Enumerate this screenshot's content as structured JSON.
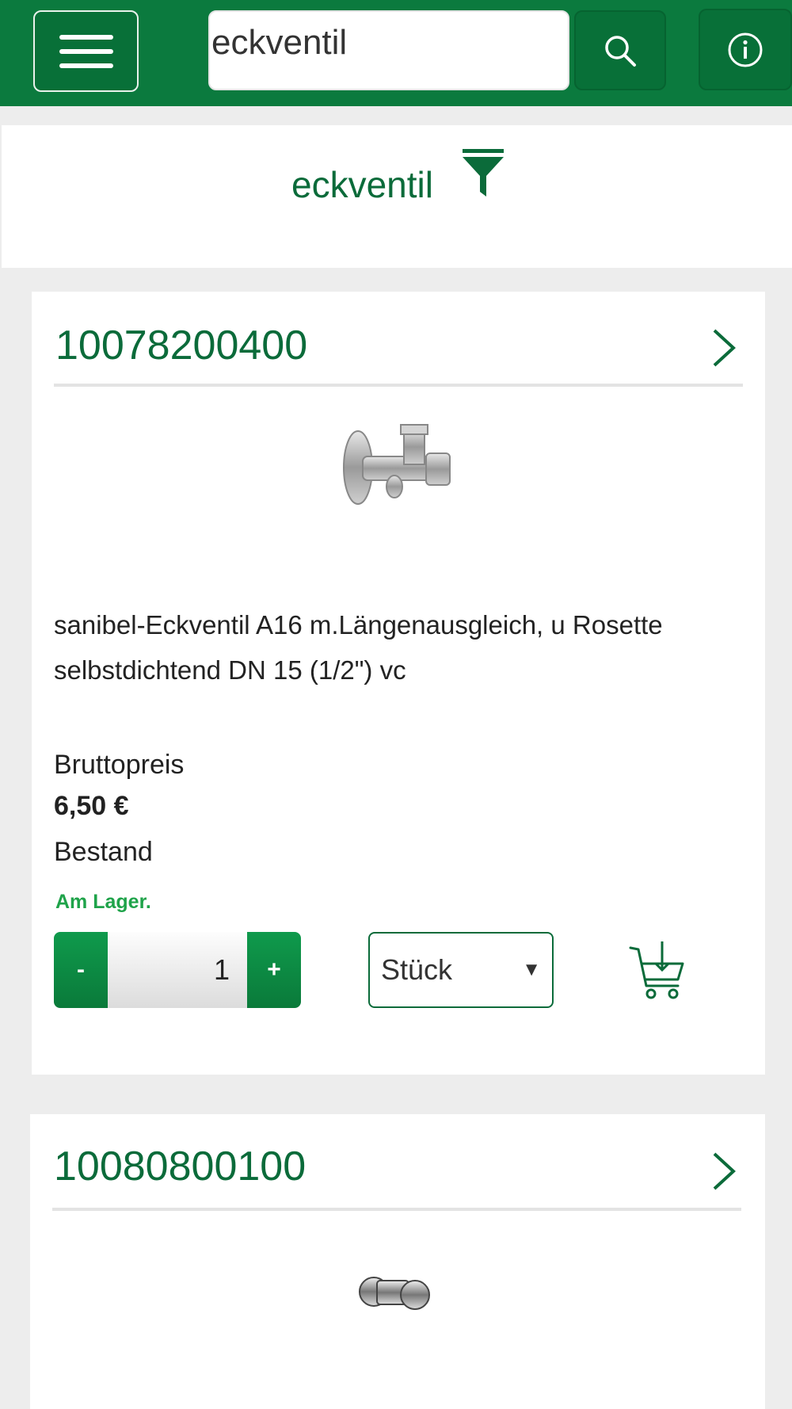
{
  "header": {
    "search_value": "eckventil",
    "menu_icon": "hamburger-icon",
    "search_icon": "search-icon",
    "info_icon": "info-icon",
    "brand_color": "#0b7a3e"
  },
  "filter": {
    "label": "eckventil",
    "icon": "filter-icon"
  },
  "products": [
    {
      "number": "10078200400",
      "description": "sanibel-Eckventil A16 m.Längenausgleich, u Rosette selbstdichtend DN 15 (1/2\") vc",
      "price_label": "Bruttopreis",
      "price": "6,50 €",
      "stock_label": "Bestand",
      "stock_status": "Am Lager.",
      "quantity": {
        "minus": "-",
        "value": "1",
        "plus": "+"
      },
      "unit": "Stück",
      "unit_arrow": "▼",
      "cart_icon": "add-to-cart-icon"
    },
    {
      "number": "10080800100"
    }
  ]
}
